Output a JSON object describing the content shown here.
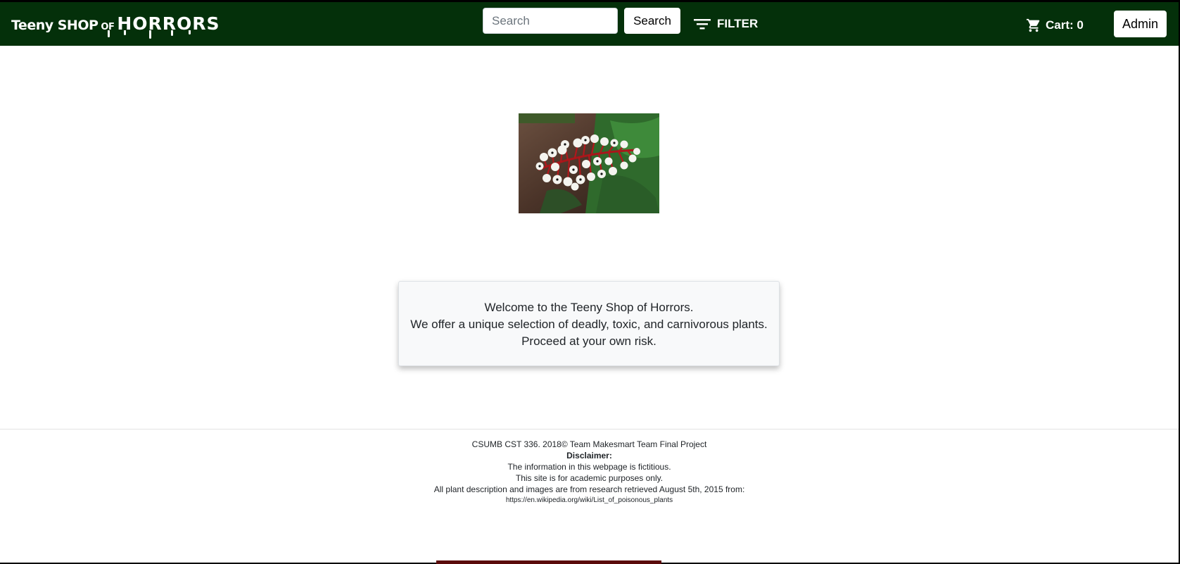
{
  "navbar": {
    "logo": {
      "part1": "Teeny SHOP",
      "part2": "OF",
      "part3": "HORRORS"
    },
    "search": {
      "placeholder": "Search",
      "button_label": "Search"
    },
    "filter": {
      "label": "FILTER",
      "icon": "filter-icon"
    },
    "cart": {
      "label": "Cart: 0",
      "icon": "cart-icon"
    },
    "admin_label": "Admin",
    "background_color": "#04300a"
  },
  "hero": {
    "image": "white-baneberry-plant-photo"
  },
  "welcome": {
    "line1": "Welcome to the Teeny Shop of Horrors.",
    "line2": "We offer a unique selection of deadly, toxic, and carnivorous plants.",
    "line3": "Proceed at your own risk."
  },
  "footer": {
    "copyright": "CSUMB CST 336. 2018© Team Makesmart Team Final Project",
    "disclaimer_title": "Disclaimer:",
    "line1": "The information in this webpage is fictitious.",
    "line2": "This site is for academic purposes only.",
    "line3": "All plant description and images are from research retrieved August 5th, 2015 from:",
    "url": "https://en.wikipedia.org/wiki/List_of_poisonous_plants"
  }
}
